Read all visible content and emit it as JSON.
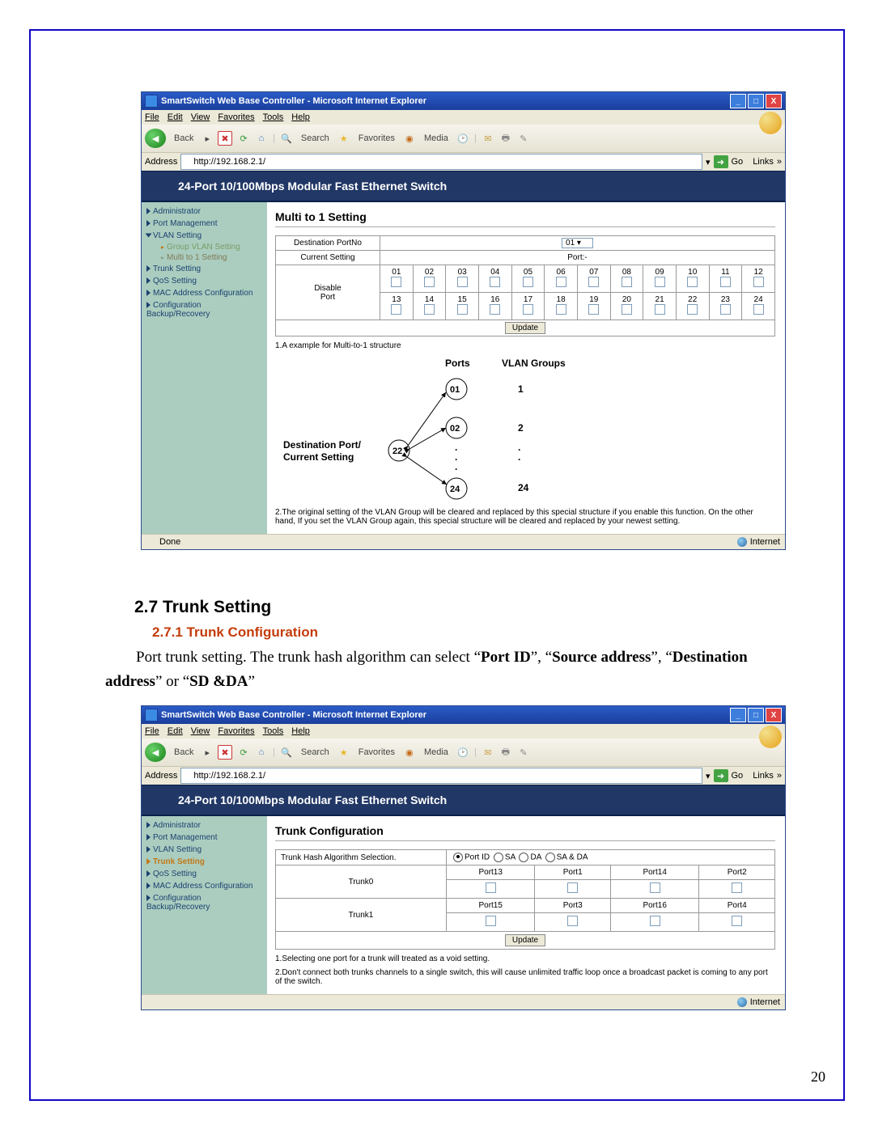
{
  "page_number": "20",
  "ie1": {
    "title": "SmartSwitch Web Base Controller - Microsoft Internet Explorer",
    "menus": {
      "file": "File",
      "edit": "Edit",
      "view": "View",
      "fav": "Favorites",
      "tools": "Tools",
      "help": "Help"
    },
    "toolbar": {
      "back": "Back",
      "search": "Search",
      "favorites": "Favorites",
      "media": "Media"
    },
    "addr_label": "Address",
    "addr_value": "http://192.168.2.1/",
    "go": "Go",
    "links": "Links",
    "banner": "24-Port 10/100Mbps Modular Fast Ethernet Switch",
    "sidebar": {
      "items": [
        "Administrator",
        "Port Management",
        "VLAN Setting",
        "Trunk Setting",
        "QoS Setting",
        "MAC Address Configuration",
        "Configuration Backup/Recovery"
      ],
      "sub": [
        "Group VLAN Setting",
        "Multi to 1 Setting"
      ]
    },
    "main": {
      "title": "Multi to 1 Setting",
      "dest_label": "Destination PortNo",
      "dest_select": "01",
      "cur_label": "Current Setting",
      "cur_value": "Port:-",
      "disable_label": "Disable\nPort",
      "ports_row1": [
        "01",
        "02",
        "03",
        "04",
        "05",
        "06",
        "07",
        "08",
        "09",
        "10",
        "11",
        "12"
      ],
      "ports_row2": [
        "13",
        "14",
        "15",
        "16",
        "17",
        "18",
        "19",
        "20",
        "21",
        "22",
        "23",
        "24"
      ],
      "update": "Update",
      "note1": "1.A example for Multi-to-1 structure",
      "diag": {
        "ports_h": "Ports",
        "vlan_h": "VLAN Groups",
        "dest": "Destination Port/\nCurrent Setting",
        "p22": "22",
        "p01": "01",
        "p02": "02",
        "p24": "24",
        "g1": "1",
        "g2": "2",
        "gdots_up": ".",
        "gdots_dn": ".",
        "g24": "24"
      },
      "note2": "2.The original setting of the VLAN Group will be cleared and replaced by this special structure if you enable this function. On the other hand, If you set the VLAN Group again, this special structure will be cleared and replaced by your newest setting."
    },
    "status": {
      "done": "Done",
      "zone": "Internet"
    }
  },
  "text": {
    "h27": "2.7 Trunk Setting",
    "h271": "2.7.1 Trunk Configuration",
    "para_pre": "Port trunk setting. The trunk hash algorithm can select “",
    "pid": "Port ID",
    "mid1": "”, “",
    "src": "Source    address",
    "mid2": "”, “",
    "dst": "Destination address",
    "mid3": "” or “",
    "sdda": "SD &DA",
    "end": "”"
  },
  "ie2": {
    "title": "SmartSwitch Web Base Controller - Microsoft Internet Explorer",
    "menus": {
      "file": "File",
      "edit": "Edit",
      "view": "View",
      "fav": "Favorites",
      "tools": "Tools",
      "help": "Help"
    },
    "toolbar": {
      "back": "Back",
      "search": "Search",
      "favorites": "Favorites",
      "media": "Media"
    },
    "addr_label": "Address",
    "addr_value": "http://192.168.2.1/",
    "go": "Go",
    "links": "Links",
    "banner": "24-Port 10/100Mbps Modular Fast Ethernet Switch",
    "sidebar": {
      "items": [
        "Administrator",
        "Port Management",
        "VLAN Setting",
        "Trunk Setting",
        "QoS Setting",
        "MAC Address Configuration",
        "Configuration Backup/Recovery"
      ],
      "active": "Trunk Setting"
    },
    "main": {
      "title": "Trunk Configuration",
      "alg_label": "Trunk Hash Algorithm Selection.",
      "alg_opts": [
        "Port ID",
        "SA",
        "DA",
        "SA & DA"
      ],
      "trunk0": {
        "label": "Trunk0",
        "ports": [
          "Port13",
          "Port1",
          "Port14",
          "Port2"
        ]
      },
      "trunk1": {
        "label": "Trunk1",
        "ports": [
          "Port15",
          "Port3",
          "Port16",
          "Port4"
        ]
      },
      "update": "Update",
      "note1": "1.Selecting one port for a trunk will treated as a void setting.",
      "note2": "2.Don't connect both trunks channels to a single switch, this will cause unlimited traffic loop once a broadcast packet is coming to any port of the switch."
    },
    "status": {
      "zone": "Internet"
    }
  }
}
